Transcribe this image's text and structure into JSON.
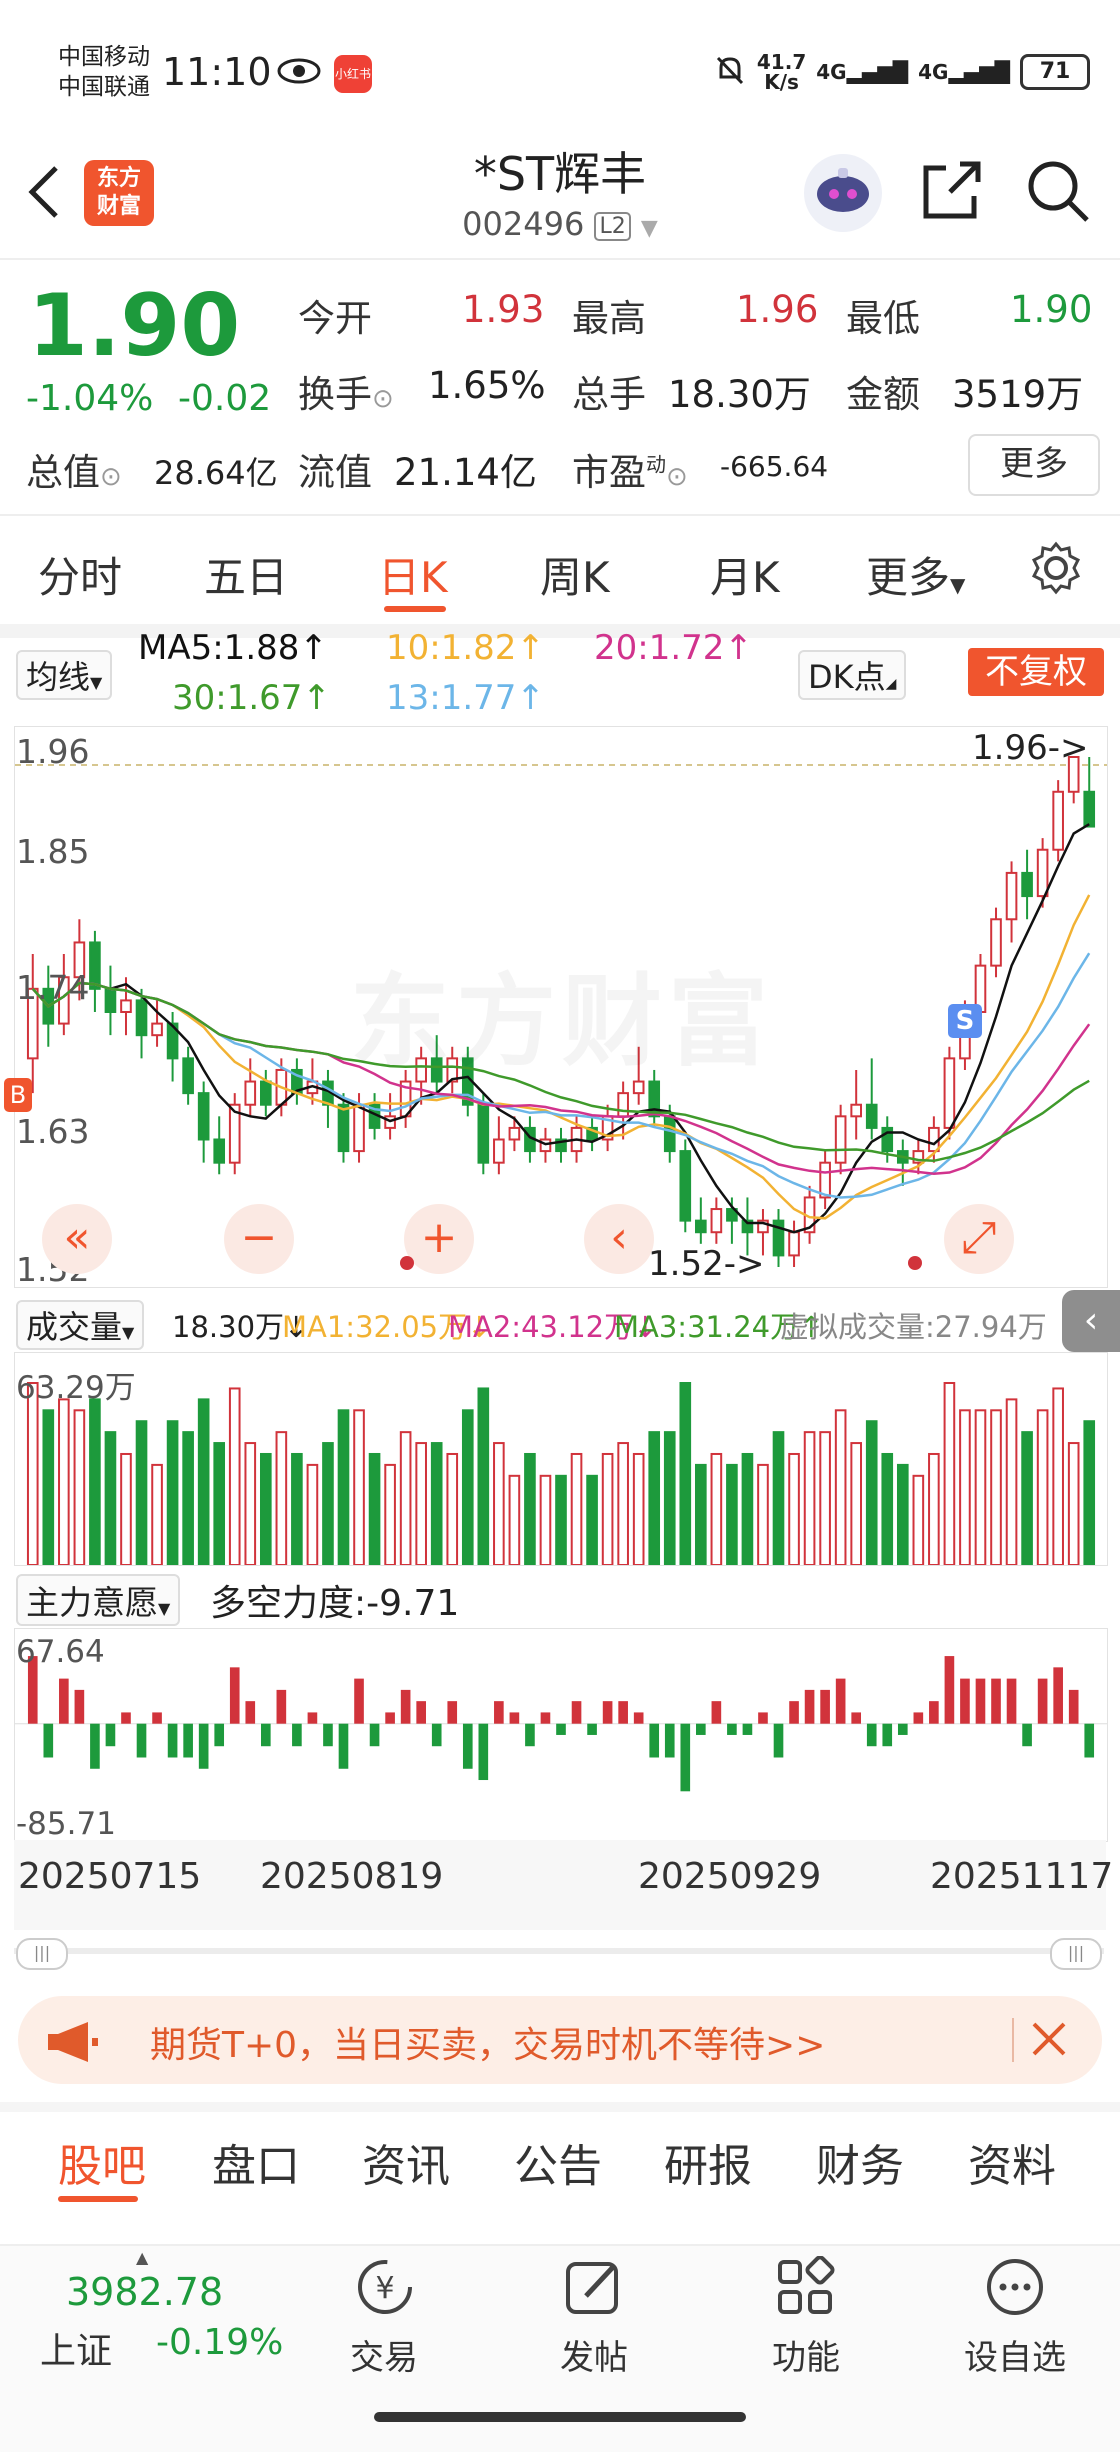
{
  "status_bar": {
    "carrier1": "中国移动",
    "carrier2": "中国联通",
    "time": "11:10",
    "app_badge": "小红书",
    "net_speed_value": "41.7",
    "net_speed_unit": "K/s",
    "sig1": "4G",
    "sig2": "4G",
    "battery": "71"
  },
  "header": {
    "logo": "东方财富",
    "title": "*ST辉丰",
    "code": "002496",
    "level": "L2"
  },
  "quote": {
    "price": "1.90",
    "change_pct": "-1.04%",
    "change": "-0.02",
    "open_label": "今开",
    "open": "1.93",
    "high_label": "最高",
    "high": "1.96",
    "low_label": "最低",
    "low": "1.90",
    "turnover_label": "换手",
    "turnover": "1.65%",
    "volume_label": "总手",
    "volume": "18.30万",
    "amount_label": "金额",
    "amount": "3519万",
    "mktcap_label": "总值",
    "mktcap": "28.64亿",
    "float_label": "流值",
    "float": "21.14亿",
    "pe_label": "市盈",
    "pe_sup": "动",
    "pe": "-665.64",
    "more": "更多"
  },
  "tabs": [
    "分时",
    "五日",
    "日K",
    "周K",
    "月K",
    "更多"
  ],
  "ma": {
    "selector": "均线",
    "ma5": "MA5:1.88↑",
    "ma10": "10:1.82↑",
    "ma20": "20:1.72↑",
    "ma30": "30:1.67↑",
    "ma13": "13:1.77↑",
    "dk": "DK点",
    "adjust": "不复权"
  },
  "colors": {
    "accent": "#f0552e",
    "up": "#d1333b",
    "down": "#1d9a3c",
    "ma5": "#111111",
    "ma10": "#f2b233",
    "ma20": "#d1338d",
    "ma30": "#3f9a2b",
    "ma13": "#6cb6e8"
  },
  "main_chart": {
    "y_labels": [
      "1.96",
      "1.85",
      "1.74",
      "1.63",
      "1.52"
    ],
    "max_marker": "1.96->",
    "min_marker": "1.52->",
    "watermark": "东方财富",
    "s_tag": "S",
    "b_tag": "B"
  },
  "volume": {
    "selector": "成交量",
    "current": "18.30万↓",
    "ma1": "MA1:32.05万↓",
    "ma2": "MA2:43.12万↓",
    "ma3": "MA3:31.24万↑",
    "virtual": "虚拟成交量:27.94万",
    "max_label": "63.29万"
  },
  "indicator": {
    "selector": "主力意愿",
    "value": "多空力度:-9.71",
    "max_label": "67.64",
    "min_label": "-85.71"
  },
  "dates": [
    "20250715",
    "20250819",
    "20250929",
    "20251117"
  ],
  "promo": {
    "text": "期货T+0，当日买卖，交易时机不等待>>"
  },
  "bottom_tabs": [
    "股吧",
    "盘口",
    "资讯",
    "公告",
    "研报",
    "财务",
    "资料"
  ],
  "nav": {
    "index_value": "3982.78",
    "index_name": "上证",
    "index_change": "-0.19%",
    "trade": "交易",
    "post": "发帖",
    "functions": "功能",
    "watchlist": "设自选"
  },
  "chart_data": {
    "type": "candlestick",
    "title": "",
    "ylim": [
      1.52,
      1.96
    ],
    "x_labels": [
      "20250715",
      "20250819",
      "20250929",
      "20251117"
    ],
    "candles": [
      [
        1.7,
        1.76,
        1.79,
        1.67
      ],
      [
        1.76,
        1.73,
        1.78,
        1.71
      ],
      [
        1.73,
        1.77,
        1.79,
        1.72
      ],
      [
        1.77,
        1.8,
        1.82,
        1.75
      ],
      [
        1.8,
        1.76,
        1.81,
        1.74
      ],
      [
        1.76,
        1.74,
        1.78,
        1.72
      ],
      [
        1.74,
        1.75,
        1.77,
        1.72
      ],
      [
        1.75,
        1.72,
        1.76,
        1.7
      ],
      [
        1.72,
        1.73,
        1.75,
        1.71
      ],
      [
        1.73,
        1.7,
        1.74,
        1.68
      ],
      [
        1.7,
        1.67,
        1.71,
        1.66
      ],
      [
        1.67,
        1.63,
        1.68,
        1.61
      ],
      [
        1.63,
        1.61,
        1.65,
        1.6
      ],
      [
        1.61,
        1.66,
        1.67,
        1.6
      ],
      [
        1.66,
        1.68,
        1.7,
        1.65
      ],
      [
        1.68,
        1.66,
        1.69,
        1.65
      ],
      [
        1.66,
        1.69,
        1.7,
        1.65
      ],
      [
        1.69,
        1.67,
        1.7,
        1.66
      ],
      [
        1.67,
        1.68,
        1.7,
        1.66
      ],
      [
        1.68,
        1.66,
        1.69,
        1.64
      ],
      [
        1.66,
        1.62,
        1.67,
        1.61
      ],
      [
        1.62,
        1.66,
        1.67,
        1.61
      ],
      [
        1.66,
        1.64,
        1.67,
        1.63
      ],
      [
        1.64,
        1.65,
        1.67,
        1.63
      ],
      [
        1.65,
        1.68,
        1.69,
        1.64
      ],
      [
        1.68,
        1.7,
        1.71,
        1.66
      ],
      [
        1.7,
        1.68,
        1.72,
        1.67
      ],
      [
        1.68,
        1.7,
        1.71,
        1.67
      ],
      [
        1.7,
        1.66,
        1.71,
        1.65
      ],
      [
        1.66,
        1.61,
        1.67,
        1.6
      ],
      [
        1.61,
        1.63,
        1.65,
        1.6
      ],
      [
        1.63,
        1.64,
        1.65,
        1.62
      ],
      [
        1.64,
        1.62,
        1.65,
        1.61
      ],
      [
        1.62,
        1.63,
        1.64,
        1.61
      ],
      [
        1.63,
        1.62,
        1.64,
        1.61
      ],
      [
        1.62,
        1.64,
        1.65,
        1.61
      ],
      [
        1.64,
        1.63,
        1.65,
        1.62
      ],
      [
        1.63,
        1.65,
        1.66,
        1.62
      ],
      [
        1.65,
        1.67,
        1.68,
        1.63
      ],
      [
        1.67,
        1.68,
        1.71,
        1.66
      ],
      [
        1.68,
        1.65,
        1.69,
        1.64
      ],
      [
        1.65,
        1.62,
        1.66,
        1.61
      ],
      [
        1.62,
        1.56,
        1.63,
        1.55
      ],
      [
        1.56,
        1.55,
        1.58,
        1.54
      ],
      [
        1.55,
        1.57,
        1.58,
        1.54
      ],
      [
        1.57,
        1.56,
        1.58,
        1.54
      ],
      [
        1.56,
        1.55,
        1.58,
        1.53
      ],
      [
        1.55,
        1.56,
        1.57,
        1.53
      ],
      [
        1.56,
        1.53,
        1.57,
        1.52
      ],
      [
        1.53,
        1.55,
        1.56,
        1.52
      ],
      [
        1.55,
        1.58,
        1.59,
        1.54
      ],
      [
        1.58,
        1.61,
        1.62,
        1.57
      ],
      [
        1.61,
        1.65,
        1.66,
        1.6
      ],
      [
        1.65,
        1.66,
        1.69,
        1.63
      ],
      [
        1.66,
        1.64,
        1.7,
        1.63
      ],
      [
        1.64,
        1.62,
        1.65,
        1.61
      ],
      [
        1.62,
        1.61,
        1.63,
        1.59
      ],
      [
        1.61,
        1.62,
        1.63,
        1.6
      ],
      [
        1.62,
        1.64,
        1.65,
        1.61
      ],
      [
        1.64,
        1.7,
        1.71,
        1.63
      ],
      [
        1.7,
        1.74,
        1.75,
        1.69
      ],
      [
        1.74,
        1.78,
        1.79,
        1.73
      ],
      [
        1.78,
        1.82,
        1.83,
        1.77
      ],
      [
        1.82,
        1.86,
        1.87,
        1.8
      ],
      [
        1.86,
        1.84,
        1.88,
        1.82
      ],
      [
        1.84,
        1.88,
        1.89,
        1.83
      ],
      [
        1.88,
        1.93,
        1.94,
        1.87
      ],
      [
        1.93,
        1.96,
        1.96,
        1.92
      ],
      [
        1.93,
        1.9,
        1.96,
        1.9
      ]
    ],
    "volume_max": 63.29,
    "indicator_range": [
      -85.71,
      67.64
    ]
  }
}
